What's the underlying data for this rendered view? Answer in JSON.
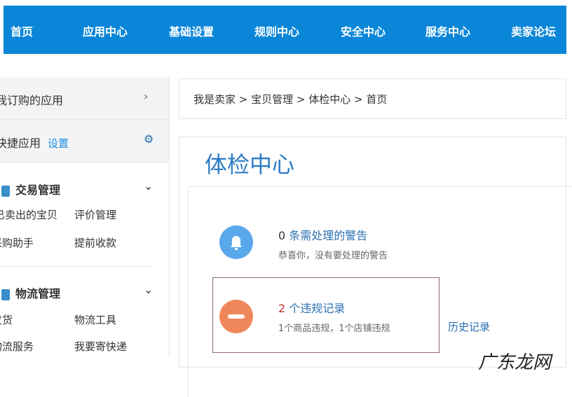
{
  "nav": [
    "首页",
    "应用中心",
    "基础设置",
    "规则中心",
    "安全中心",
    "服务中心",
    "卖家论坛"
  ],
  "sidebar": {
    "subscribed": "我订购的应用",
    "quick": "快捷应用",
    "quick_setting": "设置",
    "groups": [
      {
        "title": "交易管理",
        "items": [
          "已卖出的宝贝",
          "评价管理",
          "采购助手",
          "提前收款"
        ]
      },
      {
        "title": "物流管理",
        "items": [
          "发货",
          "物流工具",
          "物流服务",
          "我要寄快递"
        ]
      }
    ]
  },
  "breadcrumb": "我是卖家 > 宝贝管理 > 体检中心 > 首页",
  "main": {
    "title": "体检中心",
    "warning": {
      "count": "0",
      "label": "条需处理的警告",
      "desc": "恭喜你，没有要处理的警告"
    },
    "violation": {
      "count": "2",
      "label": "个违规记录",
      "desc": "1个商品违规，1个店铺违规",
      "history": "历史记录"
    }
  },
  "watermark": "广东龙网",
  "colors": {
    "nav": "#0a86d8",
    "bell": "#5aa8ec",
    "minus": "#f0875a"
  }
}
